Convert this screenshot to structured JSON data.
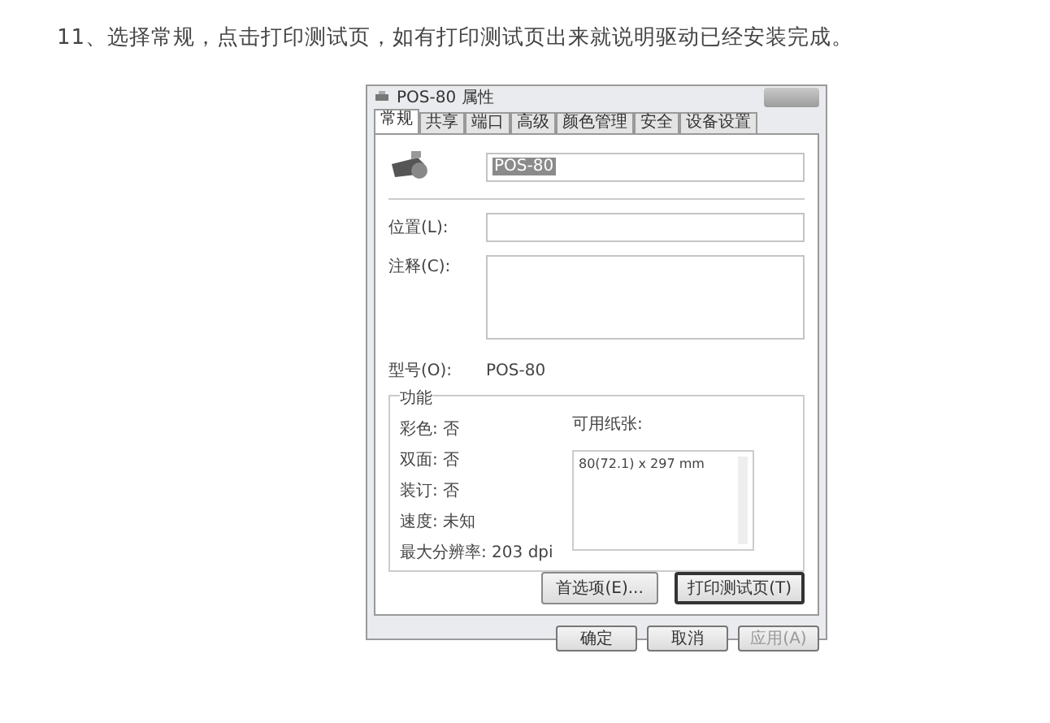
{
  "instruction": "11、选择常规，点击打印测试页，如有打印测试页出来就说明驱动已经安装完成。",
  "window": {
    "title": "POS-80 属性"
  },
  "tabs": [
    {
      "label": "常规",
      "selected": true
    },
    {
      "label": "共享",
      "selected": false
    },
    {
      "label": "端口",
      "selected": false
    },
    {
      "label": "高级",
      "selected": false
    },
    {
      "label": "颜色管理",
      "selected": false
    },
    {
      "label": "安全",
      "selected": false
    },
    {
      "label": "设备设置",
      "selected": false
    }
  ],
  "general": {
    "name_field": {
      "value": "POS-80",
      "text_selected": true
    },
    "location": {
      "label": "位置(L):"
    },
    "comment": {
      "label": "注释(C):"
    },
    "model": {
      "label": "型号(O):",
      "value": "POS-80"
    },
    "features": {
      "title": "功能",
      "items": [
        "彩色: 否",
        "双面: 否",
        "装订: 否",
        "速度: 未知",
        "最大分辨率: 203 dpi"
      ],
      "paper_label": "可用纸张:",
      "paper_sizes": [
        "80(72.1) x 297 mm"
      ]
    },
    "buttons": [
      {
        "label": "首选项(E)...",
        "focused": false
      },
      {
        "label": "打印测试页(T)",
        "focused": true
      }
    ]
  },
  "footer_buttons": [
    {
      "label": "确定",
      "disabled": false
    },
    {
      "label": "取消",
      "disabled": false
    },
    {
      "label": "应用(A)",
      "disabled": true
    }
  ]
}
